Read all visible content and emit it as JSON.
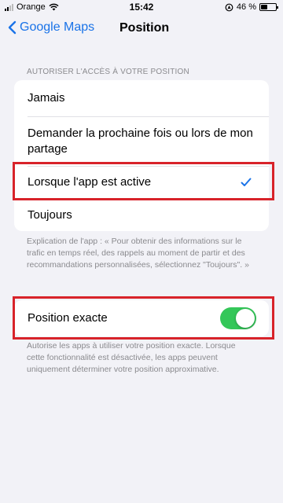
{
  "status_bar": {
    "carrier": "Orange",
    "time": "15:42",
    "battery_percent": "46 %",
    "battery_level": 0.46
  },
  "nav": {
    "back_label": "Google Maps",
    "title": "Position"
  },
  "access_section": {
    "header": "AUTORISER L'ACCÈS À VOTRE POSITION",
    "options": [
      {
        "label": "Jamais",
        "selected": false
      },
      {
        "label": "Demander la prochaine fois ou lors de mon partage",
        "selected": false
      },
      {
        "label": "Lorsque l'app est active",
        "selected": true
      },
      {
        "label": "Toujours",
        "selected": false
      }
    ],
    "footer": "Explication de l'app : « Pour obtenir des informations sur le trafic en temps réel, des rappels au moment de partir et des recommandations personnalisées, sélectionnez \"Toujours\". »"
  },
  "exact_section": {
    "label": "Position exacte",
    "toggle_on": true,
    "footer": "Autorise les apps à utiliser votre position exacte. Lorsque cette fonctionnalité est désactivée, les apps peuvent uniquement déterminer votre position approximative."
  },
  "colors": {
    "accent": "#1a73e8",
    "toggle_on": "#34c759",
    "highlight": "#d8232a",
    "background": "#f2f2f7"
  }
}
